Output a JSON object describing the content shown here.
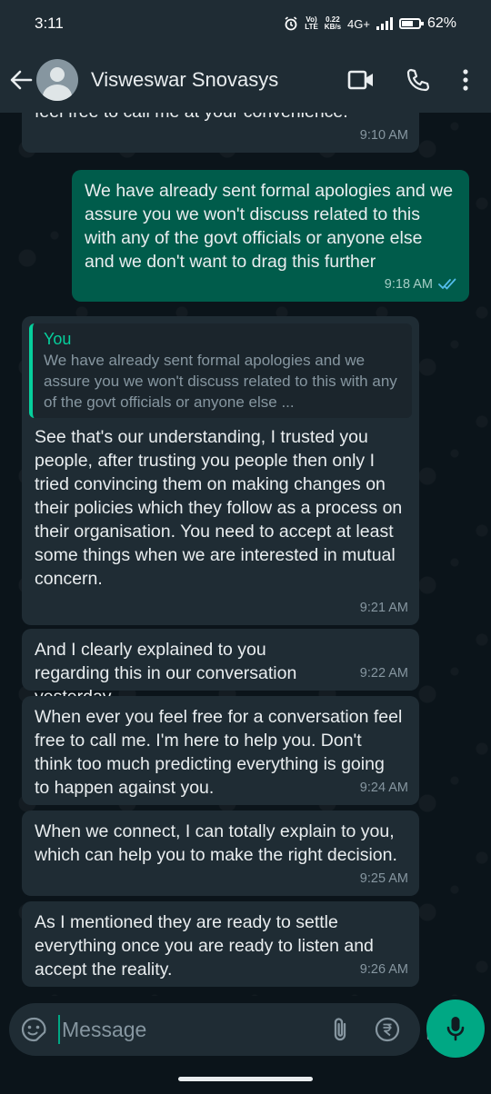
{
  "status_bar": {
    "time": "3:11",
    "volte_top": "Vo)",
    "volte_bottom": "LTE",
    "speed_top": "0.22",
    "speed_bottom": "KB/s",
    "network": "4G+",
    "battery": "62%",
    "icons": [
      "alarm-icon",
      "signal-icon",
      "battery-icon"
    ]
  },
  "header": {
    "contact_name": "Visweswar Snovasys",
    "icons": [
      "back-arrow-icon",
      "avatar",
      "video-call-icon",
      "voice-call-icon",
      "more-options-icon"
    ]
  },
  "messages": [
    {
      "direction": "in",
      "text": "feel free to call me at your convenience.",
      "time": "9:10 AM"
    },
    {
      "direction": "out",
      "text": "We have already sent formal apologies and we assure you we won't discuss related to this with any of the govt officials or anyone else and we don't want to drag this further",
      "time": "9:18 AM",
      "status": "read"
    },
    {
      "direction": "in",
      "quote": {
        "author": "You",
        "text": "We have already sent formal apologies and we assure you we won't discuss related to this with any of the govt officials or anyone else ..."
      },
      "text": "See that's our understanding, I trusted you people, after trusting you people then only I tried convincing them on making changes on their policies which they follow as a process on their organisation. You need to accept at least some things when we are interested in mutual concern.",
      "time": "9:21 AM"
    },
    {
      "direction": "in",
      "text": "And I clearly explained to you regarding this in our conversation yesterday.",
      "time": "9:22 AM"
    },
    {
      "direction": "in",
      "text": "When ever you feel free for a conversation feel free to call me. I'm here to help you. Don't think too much predicting everything is going to happen against you.",
      "time": "9:24 AM"
    },
    {
      "direction": "in",
      "text": "When we connect, I can totally explain to you, which can help you to make the right decision.",
      "time": "9:25 AM"
    },
    {
      "direction": "in",
      "text": "As I mentioned they are ready to settle everything once you are ready to listen and accept the reality.",
      "time": "9:26 AM"
    }
  ],
  "composer": {
    "placeholder": "Message",
    "icons": [
      "sticker-icon",
      "attach-icon",
      "rupee-payment-icon",
      "camera-icon",
      "microphone-icon"
    ]
  },
  "colors": {
    "background": "#0b141a",
    "header": "#1f2c34",
    "incoming_bubble": "#1f2c34",
    "outgoing_bubble": "#005c4b",
    "accent": "#00a884",
    "read_ticks": "#53bdeb"
  }
}
